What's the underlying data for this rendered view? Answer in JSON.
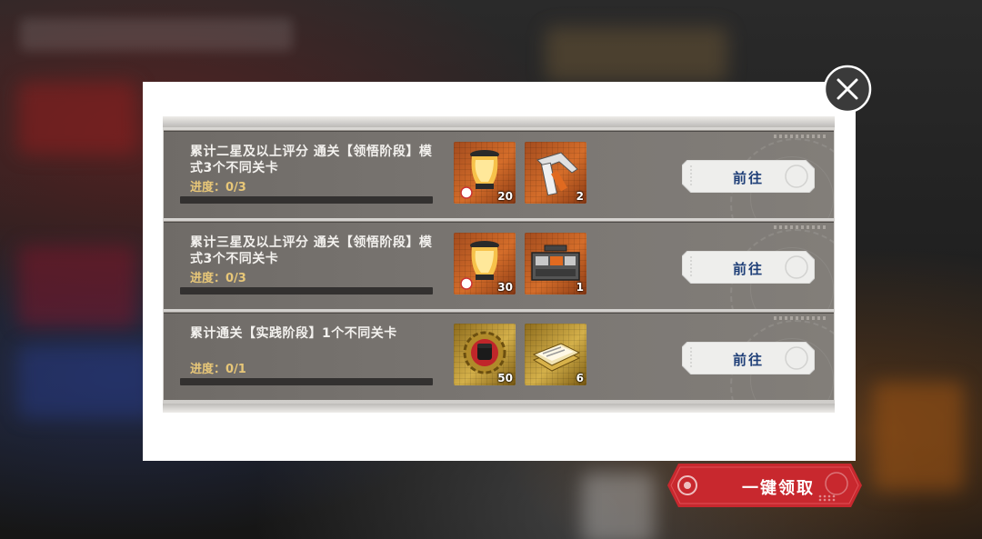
{
  "tasks": [
    {
      "title": "累计二星及以上评分 通关【领悟阶段】模式3个不同关卡",
      "progress_text": "进度：0/3",
      "progress": 0,
      "rewards": [
        {
          "icon": "lantern-icon",
          "count": "20"
        },
        {
          "icon": "wrench-tool-icon",
          "count": "2"
        }
      ],
      "button": "前往"
    },
    {
      "title": "累计三星及以上评分 通关【领悟阶段】模式3个不同关卡",
      "progress_text": "进度：0/3",
      "progress": 0,
      "rewards": [
        {
          "icon": "lantern-icon",
          "count": "30"
        },
        {
          "icon": "toolbox-icon",
          "count": "1"
        }
      ],
      "button": "前往"
    },
    {
      "title": "累计通关【实践阶段】1个不同关卡",
      "progress_text": "进度：0/1",
      "progress": 0,
      "rewards": [
        {
          "icon": "fist-gear-icon",
          "count": "50"
        },
        {
          "icon": "document-stack-icon",
          "count": "6"
        }
      ],
      "button": "前往"
    }
  ],
  "claim_all_button": "一键领取",
  "close_icon": "close-icon",
  "colors": {
    "accent_red": "#c8282e",
    "progress_gold": "#e8c778",
    "button_text_blue": "#1f3f78"
  }
}
